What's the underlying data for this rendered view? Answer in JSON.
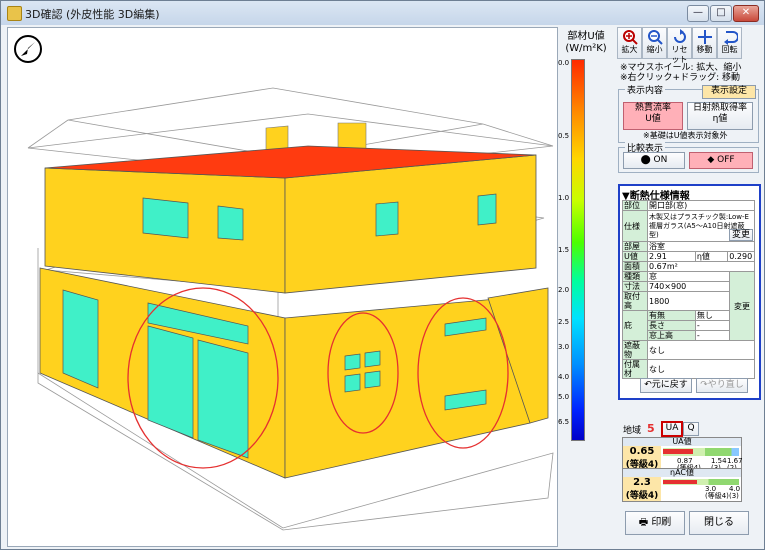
{
  "window": {
    "title": "3D確認 (外皮性能 3D編集)",
    "minimize": "—",
    "maximize": "□",
    "close": "✕"
  },
  "scale": {
    "title_line1": "部材U値",
    "title_line2": "(W/m²K)",
    "ticks": [
      "0.0",
      "0.5",
      "1.0",
      "1.5",
      "2.0",
      "2.5",
      "3.0",
      "4.0",
      "5.0",
      "6.5"
    ]
  },
  "toolbar": {
    "zoom_in": "拡大",
    "zoom_out": "縮小",
    "reset": "リセット",
    "move": "移動",
    "rotate": "回転"
  },
  "hints": {
    "line1": "※マウスホイール: 拡大、縮小",
    "line2": "※右クリック+ドラッグ: 移動"
  },
  "display": {
    "group_label": "表示内容",
    "settings_button": "表示設定",
    "heat_flow_line1": "熱貫流率",
    "heat_flow_line2": "U値",
    "solar_line1": "日射熱取得率",
    "solar_line2": "η値",
    "note": "※基礎はU値表示対象外"
  },
  "compare": {
    "group_label": "比較表示",
    "on": "ON",
    "off": "OFF"
  },
  "spec": {
    "header": "▼断熱仕様情報",
    "part_label": "部位",
    "part_value": "開口部(窓)",
    "spec_label": "仕様",
    "spec_value": "木製又はプラスチック製:Low-E複層ガラス(A5〜A10日射遮蔽型)",
    "change1": "変更",
    "room_label": "部屋",
    "room_value": "浴室",
    "u_label": "U値",
    "u_value": "2.91",
    "eta_label": "η値",
    "eta_value": "0.290",
    "area_label": "面積",
    "area_value": "0.67m²",
    "type_label": "種類",
    "type_value": "窓",
    "size_label": "寸法",
    "size_value": "740×900",
    "height_label": "取付高",
    "height_value": "1800",
    "eave_label": "庇",
    "exist_label": "有無",
    "exist_value": "無し",
    "len_label": "長さ",
    "len_value": "-",
    "winh_label": "窓上高",
    "winh_value": "-",
    "change2": "変更",
    "shade_label": "遮蔽物",
    "shade_value": "なし",
    "attach_label": "付属材",
    "attach_value": "なし",
    "undo": "元に戻す",
    "redo": "やり直し"
  },
  "region": {
    "label": "地域",
    "value": "5",
    "tab_ua": "UA",
    "tab_q": "Q"
  },
  "ua": {
    "header": "UA値",
    "value": "0.65",
    "grade": "(等級4)",
    "tick1": "0.87",
    "tick1_sub": "(等級4)",
    "tick2": "1.54",
    "tick2_sub": "(3)",
    "tick3": "1.67",
    "tick3_sub": "(2)",
    "fraction": 0.39
  },
  "eta": {
    "header": "ηAC値",
    "value": "2.3",
    "grade": "(等級4)",
    "tick1": "3.0",
    "tick1_sub": "(等級4)",
    "tick2": "4.0",
    "tick2_sub": "(3)",
    "fraction": 0.45
  },
  "bottom": {
    "print": "印刷",
    "close": "閉じる"
  },
  "colors": {
    "wall": "#ffd21e",
    "window": "#40f0c8",
    "roof_edge": "#ff3b10",
    "highlight": "#e53030",
    "accent_blue": "#1e40c8"
  }
}
